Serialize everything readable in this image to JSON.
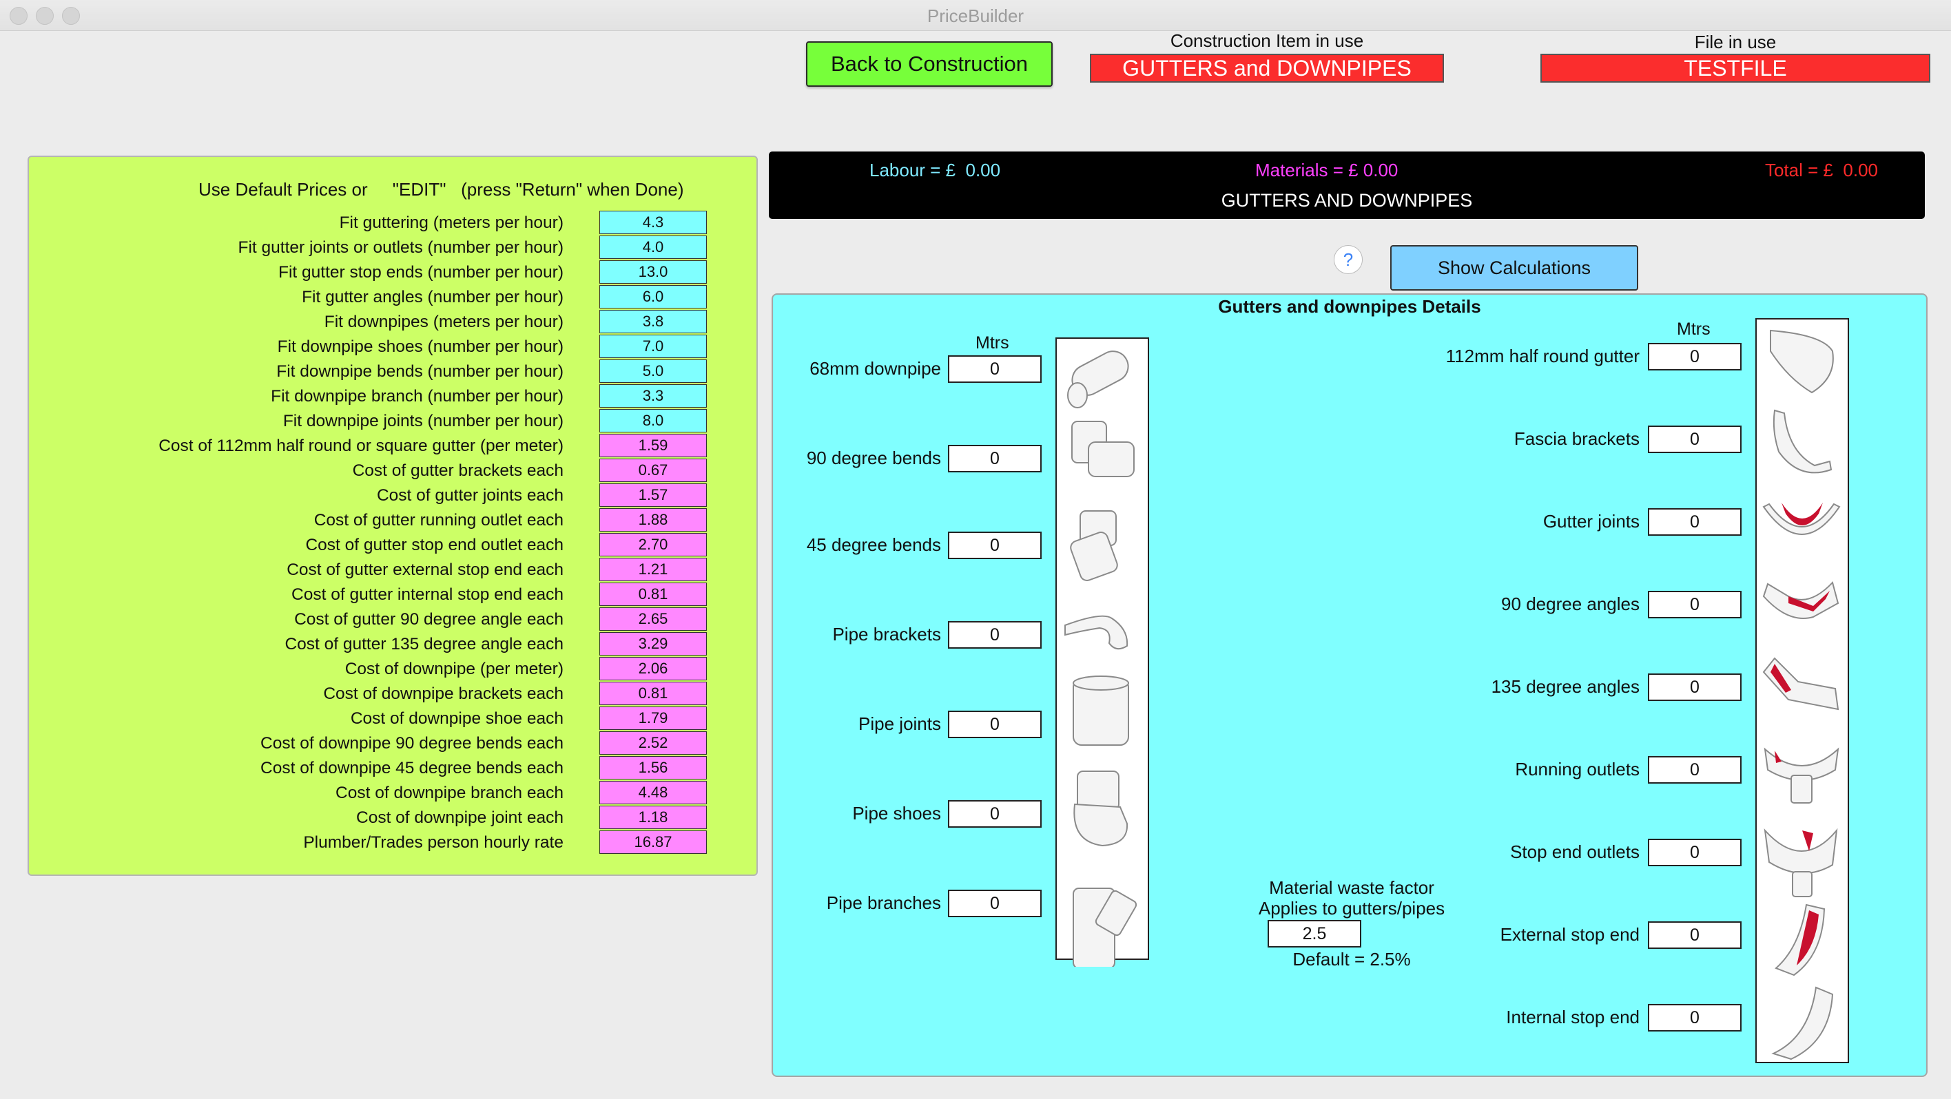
{
  "window": {
    "title": "PriceBuilder"
  },
  "header": {
    "back_button": "Back to Construction",
    "construction_label": "Construction Item in use",
    "construction_value": "GUTTERS and DOWNPIPES",
    "file_label": "File in use",
    "file_value": "TESTFILE"
  },
  "prices": {
    "title": "Use Default Prices or     \"EDIT\"   (press \"Return\" when Done)",
    "rows": [
      {
        "label": "Fit guttering (meters per hour)",
        "value": "4.3",
        "kind": "rate"
      },
      {
        "label": "Fit gutter joints or outlets (number per hour)",
        "value": "4.0",
        "kind": "rate"
      },
      {
        "label": "Fit gutter stop ends (number per hour)",
        "value": "13.0",
        "kind": "rate"
      },
      {
        "label": "Fit gutter angles (number per hour)",
        "value": "6.0",
        "kind": "rate"
      },
      {
        "label": "Fit downpipes (meters per hour)",
        "value": "3.8",
        "kind": "rate"
      },
      {
        "label": "Fit downpipe shoes (number per hour)",
        "value": "7.0",
        "kind": "rate"
      },
      {
        "label": "Fit downpipe bends (number per hour)",
        "value": "5.0",
        "kind": "rate"
      },
      {
        "label": "Fit downpipe branch (number per hour)",
        "value": "3.3",
        "kind": "rate"
      },
      {
        "label": "Fit downpipe joints (number per hour)",
        "value": "8.0",
        "kind": "rate"
      },
      {
        "label": "Cost of 112mm half round or square gutter (per meter)",
        "value": "1.59",
        "kind": "cost"
      },
      {
        "label": "Cost of gutter brackets each",
        "value": "0.67",
        "kind": "cost"
      },
      {
        "label": "Cost of gutter joints each",
        "value": "1.57",
        "kind": "cost"
      },
      {
        "label": "Cost of gutter running outlet each",
        "value": "1.88",
        "kind": "cost"
      },
      {
        "label": "Cost of gutter stop end outlet each",
        "value": "2.70",
        "kind": "cost"
      },
      {
        "label": "Cost of gutter external stop end each",
        "value": "1.21",
        "kind": "cost"
      },
      {
        "label": "Cost of gutter internal stop end each",
        "value": "0.81",
        "kind": "cost"
      },
      {
        "label": "Cost of gutter 90 degree angle each",
        "value": "2.65",
        "kind": "cost"
      },
      {
        "label": "Cost of gutter 135 degree angle each",
        "value": "3.29",
        "kind": "cost"
      },
      {
        "label": "Cost of downpipe (per meter)",
        "value": "2.06",
        "kind": "cost"
      },
      {
        "label": "Cost of downpipe brackets each",
        "value": "0.81",
        "kind": "cost"
      },
      {
        "label": "Cost of downpipe shoe each",
        "value": "1.79",
        "kind": "cost"
      },
      {
        "label": "Cost of downpipe 90 degree bends each",
        "value": "2.52",
        "kind": "cost"
      },
      {
        "label": "Cost of downpipe 45 degree bends each",
        "value": "1.56",
        "kind": "cost"
      },
      {
        "label": "Cost of downpipe branch each",
        "value": "4.48",
        "kind": "cost"
      },
      {
        "label": "Cost of downpipe joint each",
        "value": "1.18",
        "kind": "cost"
      },
      {
        "label": "Plumber/Trades person hourly rate",
        "value": "16.87",
        "kind": "cost"
      }
    ]
  },
  "summary": {
    "labour": "Labour = £  0.00",
    "materials": "Materials = £ 0.00",
    "total": "Total = £  0.00",
    "title": "GUTTERS AND DOWNPIPES",
    "colors": {
      "labour": "#7fe9ff",
      "materials": "#ff40ff",
      "total": "#ff2a2a"
    }
  },
  "actions": {
    "help": "?",
    "show_calculations": "Show Calculations"
  },
  "details": {
    "title": "Gutters and downpipes Details",
    "units_label": "Mtrs",
    "downpipe_items": [
      {
        "label": "68mm downpipe",
        "value": "0",
        "icon": "downpipe-icon"
      },
      {
        "label": "90 degree bends",
        "value": "0",
        "icon": "bend-90-icon"
      },
      {
        "label": "45 degree bends",
        "value": "0",
        "icon": "bend-45-icon"
      },
      {
        "label": "Pipe brackets",
        "value": "0",
        "icon": "pipe-bracket-icon"
      },
      {
        "label": "Pipe joints",
        "value": "0",
        "icon": "pipe-joint-icon"
      },
      {
        "label": "Pipe shoes",
        "value": "0",
        "icon": "pipe-shoe-icon"
      },
      {
        "label": "Pipe branches",
        "value": "0",
        "icon": "pipe-branch-icon"
      }
    ],
    "gutter_items": [
      {
        "label": "112mm half round gutter",
        "value": "0",
        "icon": "half-round-gutter-icon"
      },
      {
        "label": "Fascia brackets",
        "value": "0",
        "icon": "fascia-bracket-icon"
      },
      {
        "label": "Gutter joints",
        "value": "0",
        "icon": "gutter-joint-icon"
      },
      {
        "label": "90 degree angles",
        "value": "0",
        "icon": "angle-90-icon"
      },
      {
        "label": "135 degree angles",
        "value": "0",
        "icon": "angle-135-icon"
      },
      {
        "label": "Running outlets",
        "value": "0",
        "icon": "running-outlet-icon"
      },
      {
        "label": "Stop end outlets",
        "value": "0",
        "icon": "stop-end-outlet-icon"
      },
      {
        "label": "External stop end",
        "value": "0",
        "icon": "external-stop-end-icon"
      },
      {
        "label": "Internal stop end",
        "value": "0",
        "icon": "internal-stop-end-icon"
      }
    ],
    "waste": {
      "line1": "Material waste factor",
      "line2": "Applies to gutters/pipes",
      "value": "2.5",
      "default": "Default = 2.5%"
    }
  },
  "colors": {
    "rate_box": "#7fffff",
    "cost_box": "#ff88ff",
    "left_panel": "#ccff66",
    "details_panel": "#80ffff"
  }
}
